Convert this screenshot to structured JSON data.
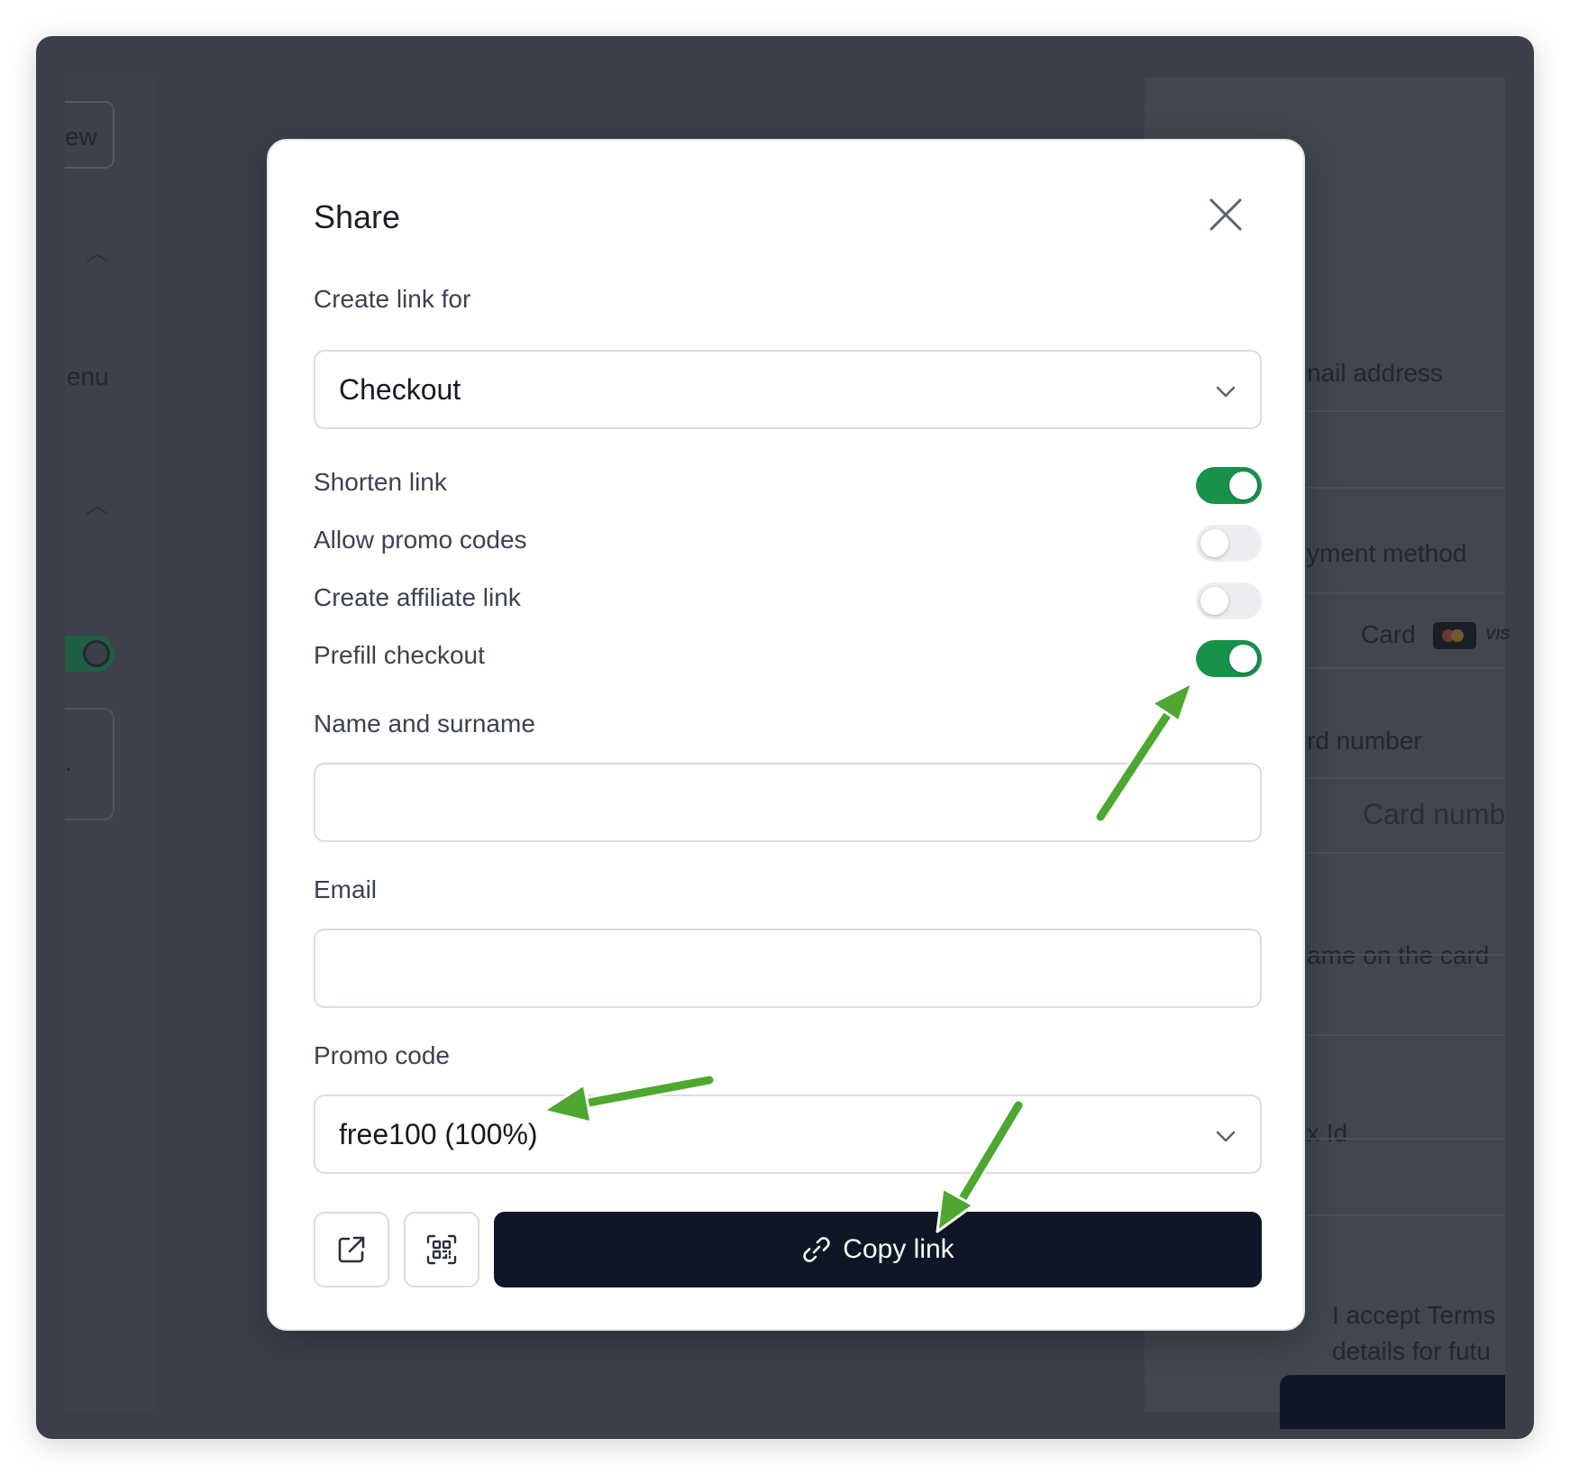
{
  "background": {
    "left_fragments": {
      "top_button": "ew",
      "menu_label": "enu",
      "dot": "."
    },
    "right_fragments": {
      "email_label": "nail address",
      "payment_label": "yment method",
      "card_label": "Card",
      "card_brand": "VIS",
      "card_number_label": "rd number",
      "card_number_placeholder": "Card numb",
      "name_on_card_label": "ame on the card",
      "tax_id_label": "x Id",
      "terms_line1": "I accept Terms",
      "terms_line2": "details for futu"
    }
  },
  "modal": {
    "title": "Share",
    "close_icon": "close-icon",
    "create_link_for": {
      "label": "Create link for",
      "value": "Checkout"
    },
    "toggles": [
      {
        "label": "Shorten link",
        "on": true
      },
      {
        "label": "Allow promo codes",
        "on": false
      },
      {
        "label": "Create affiliate link",
        "on": false
      },
      {
        "label": "Prefill checkout",
        "on": true
      }
    ],
    "name_field": {
      "label": "Name and surname",
      "value": "",
      "placeholder": ""
    },
    "email_field": {
      "label": "Email",
      "value": "",
      "placeholder": ""
    },
    "promo_code": {
      "label": "Promo code",
      "value": "free100 (100%)"
    },
    "actions": {
      "open_icon": "external-link-icon",
      "qr_icon": "qr-code-icon",
      "copy_label": "Copy link",
      "copy_icon": "link-icon"
    }
  },
  "colors": {
    "toggle_on": "#16924a",
    "toggle_off": "#ebedf0",
    "primary_button": "#0f1626",
    "annotation_arrow": "#4ea72e"
  }
}
